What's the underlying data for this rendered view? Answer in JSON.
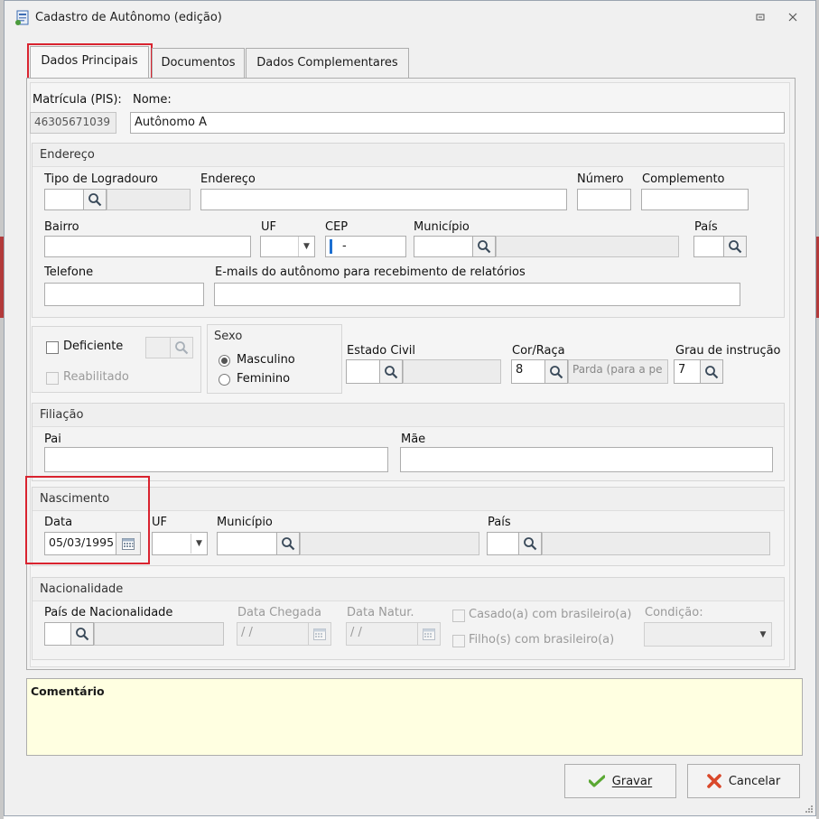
{
  "window": {
    "title": "Cadastro de Autônomo (edição)"
  },
  "tabs": [
    {
      "label": "Dados Principais",
      "active": true
    },
    {
      "label": "Documentos",
      "active": false
    },
    {
      "label": "Dados Complementares",
      "active": false
    }
  ],
  "identificacao": {
    "matricula_label": "Matrícula (PIS):",
    "matricula_value": "46305671039",
    "nome_label": "Nome:",
    "nome_value": "Autônomo A"
  },
  "endereco": {
    "group_title": "Endereço",
    "tipo_logradouro_label": "Tipo de Logradouro",
    "endereco_label": "Endereço",
    "numero_label": "Número",
    "complemento_label": "Complemento",
    "bairro_label": "Bairro",
    "uf_label": "UF",
    "cep_label": "CEP",
    "cep_value": "-",
    "municipio_label": "Município",
    "pais_label": "País",
    "telefone_label": "Telefone",
    "emails_label": "E-mails do autônomo para recebimento de relatórios"
  },
  "deficiencia": {
    "deficiente_label": "Deficiente",
    "reabilitado_label": "Reabilitado"
  },
  "sexo": {
    "group_title": "Sexo",
    "options": [
      {
        "label": "Masculino",
        "selected": true
      },
      {
        "label": "Feminino",
        "selected": false
      }
    ]
  },
  "estado_civil": {
    "label": "Estado Civil"
  },
  "cor_raca": {
    "label": "Cor/Raça",
    "code": "8",
    "description": "Parda (para a pe"
  },
  "grau_instrucao": {
    "label": "Grau de instrução",
    "code": "7"
  },
  "filiacao": {
    "group_title": "Filiação",
    "pai_label": "Pai",
    "mae_label": "Mãe"
  },
  "nascimento": {
    "group_title": "Nascimento",
    "data_label": "Data",
    "data_value": "05/03/1995",
    "uf_label": "UF",
    "municipio_label": "Município",
    "pais_label": "País"
  },
  "nacionalidade": {
    "group_title": "Nacionalidade",
    "pais_label": "País de Nacionalidade",
    "data_chegada_label": "Data Chegada",
    "data_chegada_value": "/ /",
    "data_natur_label": "Data Natur.",
    "data_natur_value": "/ /",
    "casado_label": "Casado(a) com brasileiro(a)",
    "filhos_label": "Filho(s) com brasileiro(a)",
    "condicao_label": "Condição:"
  },
  "comentario": {
    "label": "Comentário"
  },
  "footer": {
    "gravar_label": "Gravar",
    "cancelar_label": "Cancelar"
  },
  "colors": {
    "highlight_red": "#d9232f",
    "comment_bg": "#ffffe1",
    "check_green": "#5aa832",
    "cancel_red": "#d9482a"
  }
}
